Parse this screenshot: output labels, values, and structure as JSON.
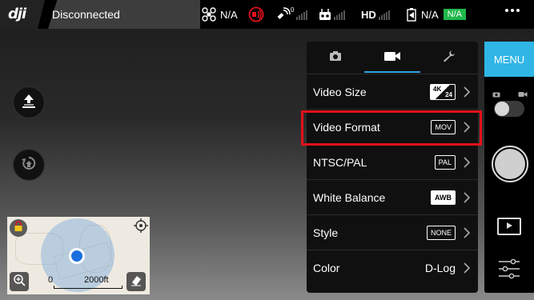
{
  "app": {
    "brand": "dji"
  },
  "status_bar": {
    "connection": "Disconnected",
    "aircraft_status": "N/A",
    "gps_signal_count": "0",
    "hd_label": "HD",
    "battery_status": "N/A",
    "battery_badge": "N/A",
    "colors": {
      "badge_green": "#1fb84a",
      "warning_red": "#e3101b"
    }
  },
  "left_controls": {
    "takeoff_icon": "takeoff-icon",
    "return_home_icon": "return-home-icon"
  },
  "minimap": {
    "scale_start": "0",
    "scale_end": "2000ft"
  },
  "settings_panel": {
    "tabs": [
      {
        "icon": "camera-icon"
      },
      {
        "icon": "video-camera-icon",
        "active": true
      },
      {
        "icon": "wrench-icon"
      }
    ],
    "rows": [
      {
        "label": "Video Size",
        "value_top": "4K",
        "value_bottom": "24"
      },
      {
        "label": "Video Format",
        "value": "MOV",
        "highlighted": true
      },
      {
        "label": "NTSC/PAL",
        "value": "PAL"
      },
      {
        "label": "White Balance",
        "value": "AWB"
      },
      {
        "label": "Style",
        "value": "NONE"
      },
      {
        "label": "Color",
        "value": "D-Log"
      }
    ],
    "accent_color": "#2aa7e0"
  },
  "sidebar": {
    "menu_label": "MENU",
    "menu_color": "#2fb6e6"
  }
}
